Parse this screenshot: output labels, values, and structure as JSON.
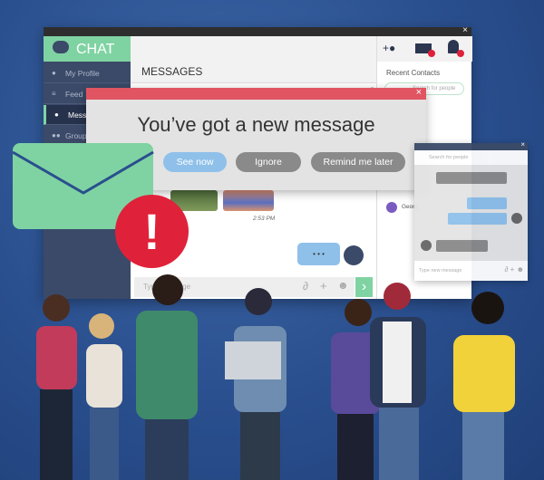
{
  "app": {
    "logo": "CHAT",
    "close": "×"
  },
  "sidebar": {
    "items": [
      {
        "label": "My Profile",
        "icon": "user-icon"
      },
      {
        "label": "Feed",
        "icon": "menu-icon"
      },
      {
        "label": "Messages",
        "icon": "chat-icon",
        "active": true
      },
      {
        "label": "Groups",
        "icon": "group-icon"
      }
    ]
  },
  "content": {
    "title": "MESSAGES",
    "timestamp": "2:53 PM",
    "typing": "• • •",
    "input_placeholder": "Type message",
    "send": "›"
  },
  "right_panel": {
    "title": "Recent Contacts",
    "search_placeholder": "Search for people",
    "contact": "Georg"
  },
  "popup": {
    "title": "You’ve got a new message",
    "buttons": [
      "See now",
      "Ignore",
      "Remind me later"
    ],
    "close": "×"
  },
  "chat2": {
    "search_placeholder": "Search for people",
    "input_placeholder": "Type new message",
    "close": "×"
  },
  "colors": {
    "green": "#7fd3a2",
    "red": "#e05561",
    "alert": "#e0213a",
    "blue": "#8fc0ea",
    "navy": "#3b4a68"
  }
}
